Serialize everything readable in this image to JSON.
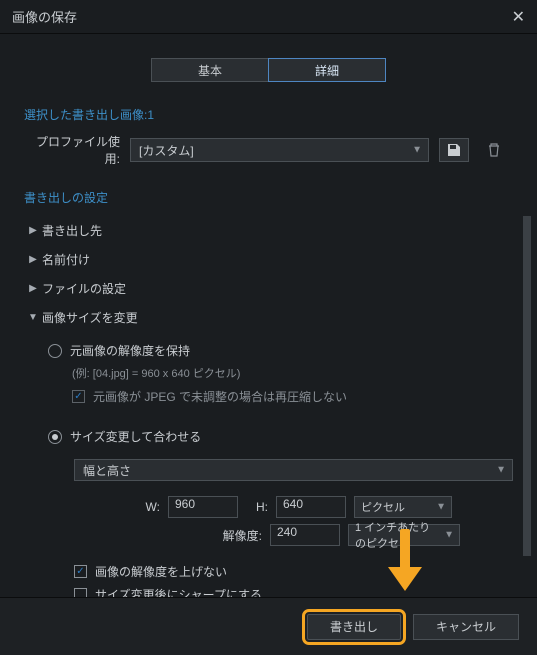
{
  "title": "画像の保存",
  "tabs": {
    "basic": "基本",
    "advanced": "詳細"
  },
  "selected_images": {
    "label": "選択した書き出し画像:",
    "count": "1"
  },
  "profile": {
    "label": "プロファイル使用:",
    "value": "[カスタム]",
    "save_icon": "save-icon",
    "delete_icon": "trash-icon"
  },
  "export_settings_title": "書き出しの設定",
  "accordions": {
    "destination": "書き出し先",
    "naming": "名前付け",
    "file_settings": "ファイルの設定",
    "image_size": "画像サイズを変更"
  },
  "image_size": {
    "radio_keep": "元画像の解像度を保持",
    "example": "(例: [04.jpg] = 960 x 640 ピクセル)",
    "cb_no_recompress": "元画像が JPEG で未調整の場合は再圧縮しない",
    "radio_fit": "サイズ変更して合わせる",
    "fit_mode": "幅と高さ",
    "w_label": "W:",
    "w_value": "960",
    "h_label": "H:",
    "h_value": "640",
    "wh_unit": "ピクセル",
    "res_label": "解像度:",
    "res_value": "240",
    "res_unit": "1 インチあたりのピクセ",
    "cb_no_upscale": "画像の解像度を上げない",
    "cb_sharpen": "サイズ変更後にシャープにする"
  },
  "footer": {
    "export": "書き出し",
    "cancel": "キャンセル"
  }
}
